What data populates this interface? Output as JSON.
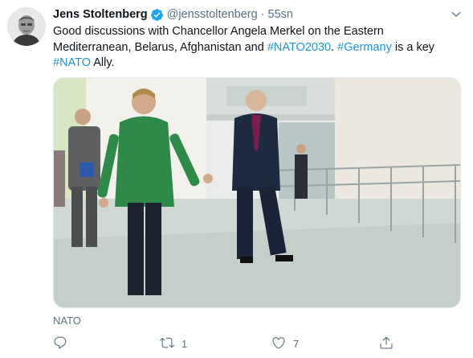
{
  "tweet": {
    "author_name": "Jens Stoltenberg",
    "handle": "@jensstoltenberg",
    "separator": "·",
    "timestamp": "55sn",
    "text_1": "Good discussions with Chancellor Angela Merkel on the Eastern Mediterranean, Belarus, Afghanistan and ",
    "hashtag_1": "#NATO2030",
    "text_2": ". ",
    "hashtag_2": "#Germany",
    "text_3": " is a key ",
    "hashtag_3": "#NATO",
    "text_4": " Ally.",
    "source_label": "NATO"
  },
  "actions": {
    "reply_count": "",
    "retweet_count": "1",
    "like_count": "7"
  },
  "icons": {
    "verified": "verified-badge-icon",
    "caret": "chevron-down-icon",
    "reply": "reply-icon",
    "retweet": "retweet-icon",
    "like": "heart-icon",
    "share": "share-icon"
  },
  "colors": {
    "hashtag": "#1b95e0",
    "muted": "#5b7083",
    "verified": "#1da1f2"
  }
}
